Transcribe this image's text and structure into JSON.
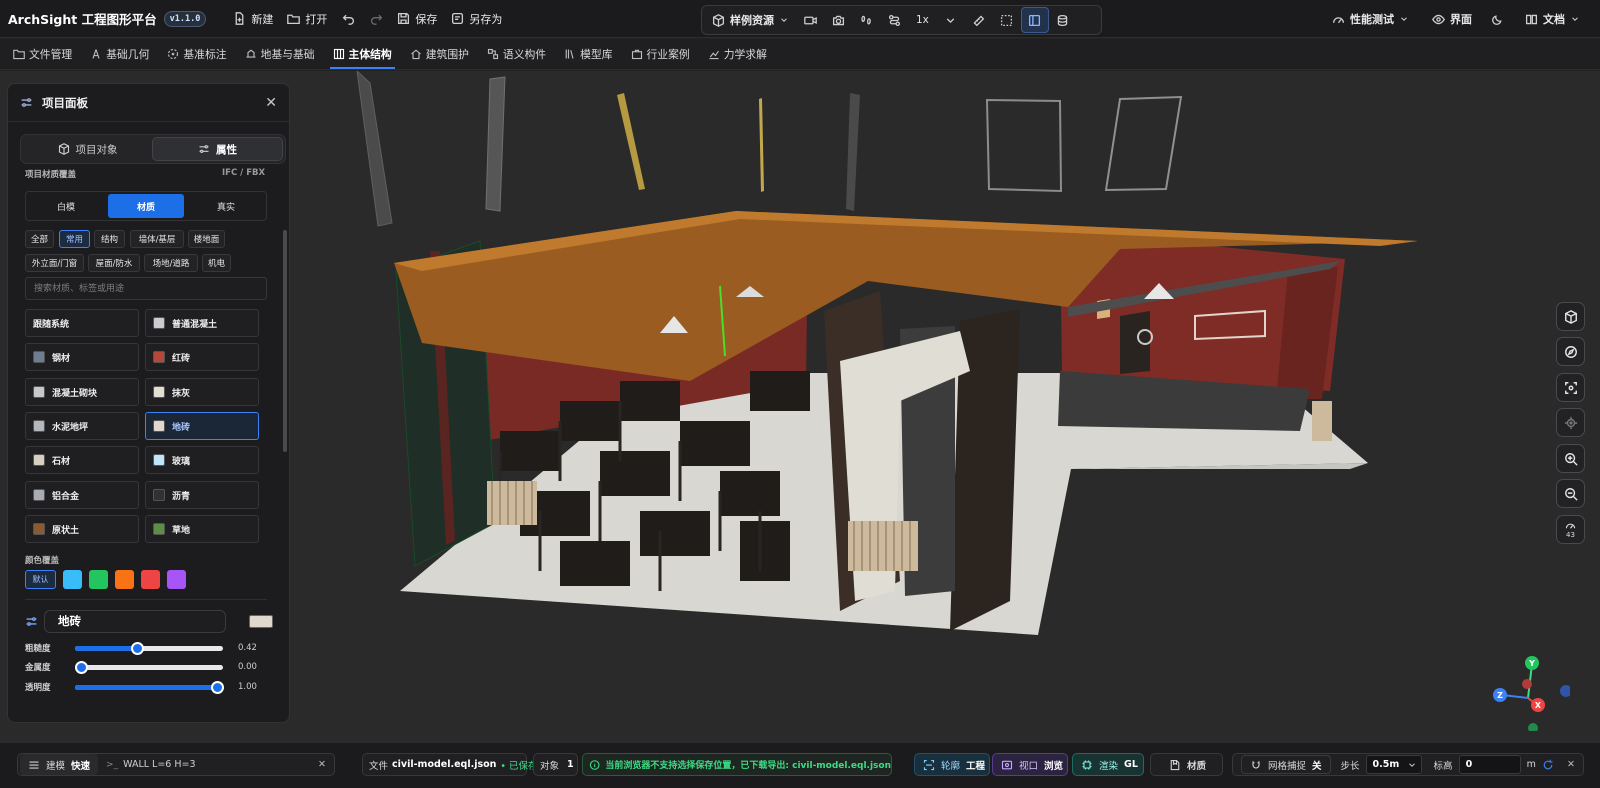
{
  "app": {
    "title": "ArchSight 工程图形平台",
    "version": "v1.1.0"
  },
  "toolbar": {
    "new_label": "新建",
    "open_label": "打开",
    "save_label": "保存",
    "saveas_label": "另存为",
    "sample_label": "样例资源",
    "zoom_label": "1x",
    "perf_label": "性能测试",
    "ui_label": "界面",
    "docs_label": "文档"
  },
  "menu": [
    {
      "label": "文件管理",
      "icon": "folder-icon"
    },
    {
      "label": "基础几何",
      "icon": "compass-icon"
    },
    {
      "label": "基准标注",
      "icon": "target-icon"
    },
    {
      "label": "地基与基础",
      "icon": "foundation-icon"
    },
    {
      "label": "主体结构",
      "icon": "columns-icon"
    },
    {
      "label": "建筑围护",
      "icon": "house-icon"
    },
    {
      "label": "语义构件",
      "icon": "component-icon"
    },
    {
      "label": "模型库",
      "icon": "library-icon"
    },
    {
      "label": "行业案例",
      "icon": "briefcase-icon"
    },
    {
      "label": "力学求解",
      "icon": "chart-icon"
    }
  ],
  "menu_active": "主体结构",
  "panel": {
    "title": "项目面板",
    "tab_objects": "项目对象",
    "tab_props": "属性",
    "override_label": "项目材质覆盖",
    "override_formats": "IFC / FBX",
    "modes": [
      "白模",
      "材质",
      "真实"
    ],
    "mode_active": "材质",
    "filters": [
      "全部",
      "常用",
      "结构",
      "墙体/基层",
      "楼地面",
      "外立面/门窗",
      "屋面/防水",
      "场地/道路",
      "机电"
    ],
    "filter_active": "常用",
    "search_placeholder": "搜索材质、标签或用途",
    "materials": [
      {
        "name": "跟随系统",
        "color": ""
      },
      {
        "name": "普通混凝土",
        "color": "#c9ccd1"
      },
      {
        "name": "钢材",
        "color": "#6f7d93"
      },
      {
        "name": "红砖",
        "color": "#b5483a"
      },
      {
        "name": "混凝土砌块",
        "color": "#c6c9cc"
      },
      {
        "name": "抹灰",
        "color": "#e3ddd2"
      },
      {
        "name": "水泥地坪",
        "color": "#b4b8bd"
      },
      {
        "name": "地砖",
        "color": "#e0d8cc"
      },
      {
        "name": "石材",
        "color": "#d7cfbf"
      },
      {
        "name": "玻璃",
        "color": "#bfe6fb"
      },
      {
        "name": "铝合金",
        "color": "#a9acb2"
      },
      {
        "name": "沥青",
        "color": "#2f3235"
      },
      {
        "name": "原状土",
        "color": "#8a5a35"
      },
      {
        "name": "草地",
        "color": "#5a8f45"
      }
    ],
    "material_active": "地砖",
    "color_override_label": "颜色覆盖",
    "color_default_label": "默认",
    "colors": [
      "#38bdf8",
      "#22c55e",
      "#f97316",
      "#ef4444",
      "#a855f7"
    ],
    "current_material": "地砖",
    "current_color": "#e0d8cc",
    "sliders": [
      {
        "label": "粗糙度",
        "value": 0.42,
        "display": "0.42"
      },
      {
        "label": "金属度",
        "value": 0.0,
        "display": "0.00"
      },
      {
        "label": "透明度",
        "value": 1.0,
        "display": "1.00"
      }
    ]
  },
  "right_tools": {
    "zoom_level": "43"
  },
  "axis": {
    "y": "Y",
    "z": "Z",
    "x": "X"
  },
  "status": {
    "mode_label": "建模",
    "mode_value": "快速",
    "cmd_value": "WALL L=6 H=3",
    "file_label": "文件",
    "file_name": "civil-model.eql.json",
    "file_state": "• 已保存",
    "objects_label": "对象",
    "objects_count": "1",
    "message": "当前浏览器不支持选择保存位置，已下载导出: civil-model.eql.json",
    "outline_label": "轮廓",
    "outline_value": "工程",
    "view_label": "视口",
    "view_value": "浏览",
    "render_label": "渲染",
    "render_value": "GL",
    "material_label": "材质",
    "snap_label": "网格捕捉",
    "snap_value": "关",
    "step_label": "步长",
    "step_value": "0.5m",
    "elev_label": "标高",
    "elev_value": "0",
    "elev_unit": "m"
  }
}
